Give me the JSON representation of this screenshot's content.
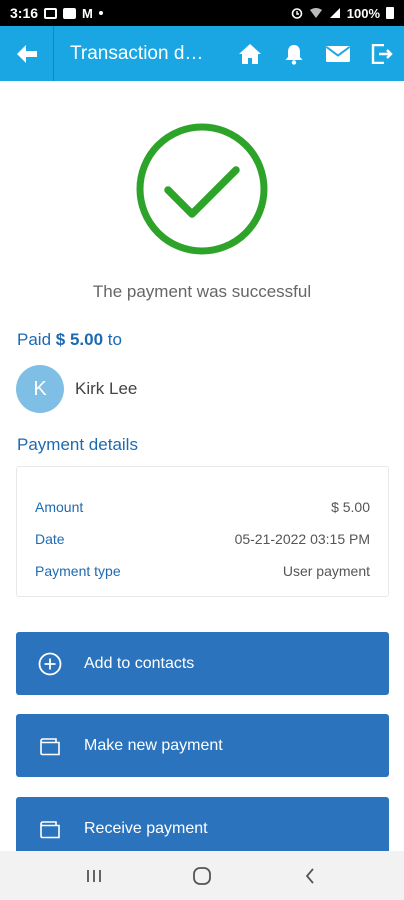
{
  "status_bar": {
    "time": "3:16",
    "battery": "100%"
  },
  "app_bar": {
    "title": "Transaction de…"
  },
  "success": {
    "message": "The payment was successful"
  },
  "paid": {
    "prefix": "Paid",
    "amount": "$ 5.00",
    "suffix": "to"
  },
  "payee": {
    "initial": "K",
    "name": "Kirk Lee"
  },
  "payment_details": {
    "title": "Payment details",
    "rows": [
      {
        "label": "Amount",
        "value": "$ 5.00"
      },
      {
        "label": "Date",
        "value": "05-21-2022 03:15 PM"
      },
      {
        "label": "Payment type",
        "value": "User payment"
      }
    ]
  },
  "actions": [
    {
      "label": "Add to contacts",
      "icon": "plus-circle-icon"
    },
    {
      "label": "Make new payment",
      "icon": "wallet-icon"
    },
    {
      "label": "Receive payment",
      "icon": "wallet-icon"
    }
  ],
  "colors": {
    "app_bar": "#1aa6e3",
    "accent": "#1e6ab1",
    "button": "#2b73bc",
    "success": "#2ea32a",
    "avatar": "#7fbfe6"
  },
  "icons": {
    "back": "arrow-left-icon",
    "home": "home-icon",
    "notifications": "bell-icon",
    "mail": "envelope-icon",
    "logout": "exit-icon",
    "nav_recents": "recents-icon",
    "nav_home": "circle-home-icon",
    "nav_back": "chevron-left-icon"
  }
}
